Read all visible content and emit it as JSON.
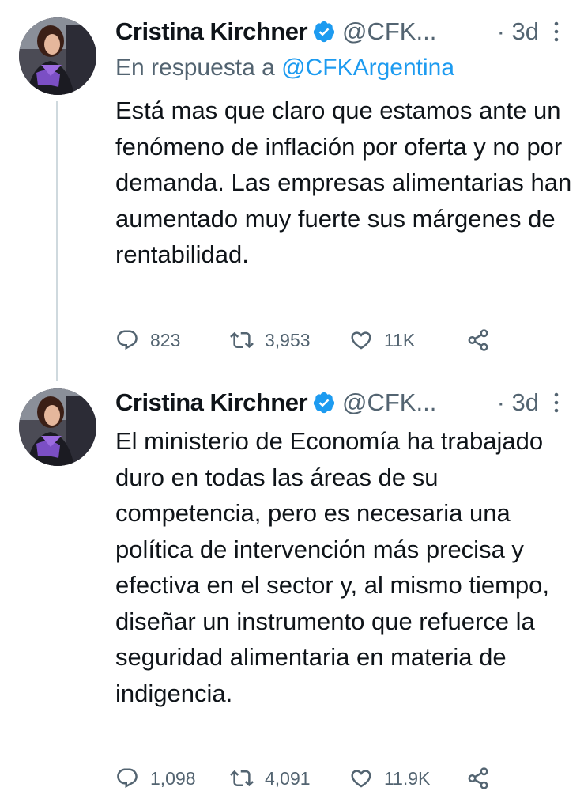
{
  "tweets": [
    {
      "author_name": "Cristina Kirchner",
      "handle": "@CFK...",
      "time": "· 3d",
      "reply_prefix": "En respuesta a",
      "reply_handle": "@CFKArgentina",
      "text": "Está mas que claro que estamos ante un fenómeno de inflación por oferta y no por demanda. Las empresas alimentarias han aumentado muy fuerte sus márgenes de rentabilidad.",
      "replies": "823",
      "retweets": "3,953",
      "likes": "11K"
    },
    {
      "author_name": "Cristina Kirchner",
      "handle": "@CFK...",
      "time": "· 3d",
      "text": "El ministerio de Economía ha trabajado duro en todas las áreas de su competencia, pero es necesaria una política de intervención más precisa y efectiva en el sector y, al mismo tiempo, diseñar un instrumento que refuerce la seguridad alimentaria en materia de indigencia.",
      "replies": "1,098",
      "retweets": "4,091",
      "likes": "11.9K"
    }
  ],
  "colors": {
    "text": "#0f1419",
    "secondary": "#536471",
    "mention": "#1d9bf0",
    "verified": "#1d9bf0",
    "thread_line": "#cfd9de"
  },
  "icons": [
    "verified-badge-icon",
    "more-icon",
    "reply-icon",
    "retweet-icon",
    "like-icon",
    "share-icon"
  ]
}
